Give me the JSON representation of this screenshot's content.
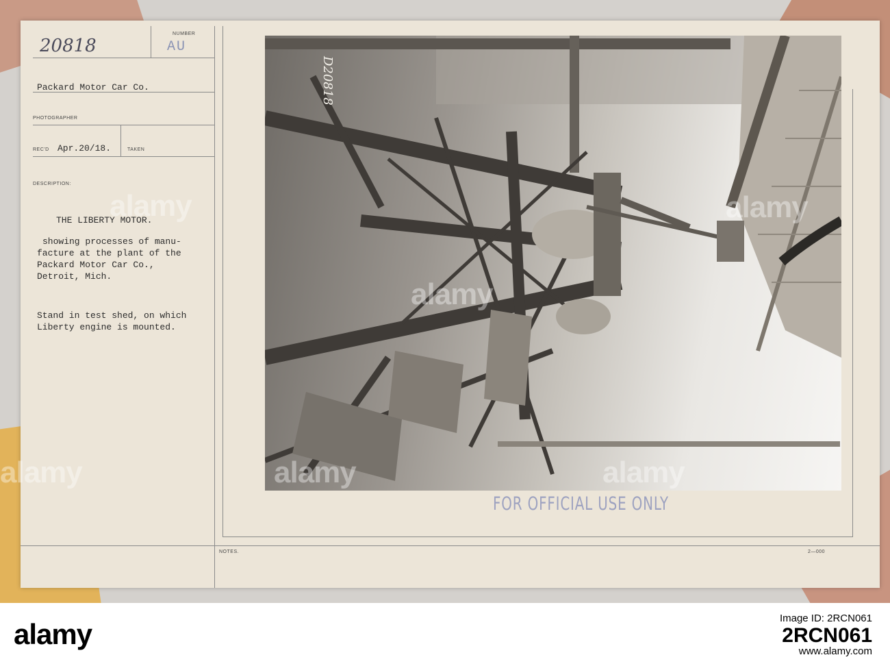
{
  "card": {
    "number_label": "NUMBER",
    "number_handwritten": "20818",
    "number_stamp": "AU",
    "source_value": "Packard Motor Car Co.",
    "photographer_label": "PHOTOGRAPHER",
    "recd_label": "REC'D",
    "recd_value": "Apr.20/18.",
    "taken_label": "TAKEN",
    "description_label": "DESCRIPTION:",
    "title": "THE LIBERTY MOTOR.",
    "desc_lines": [
      "showing processes of manu-",
      "facture at the plant of the",
      "Packard Motor Car Co.,",
      "Detroit, Mich."
    ],
    "caption_lines": [
      "Stand in test shed, on which",
      "Liberty engine is mounted."
    ],
    "notes_label": "NOTES.",
    "form_code": "2—000",
    "photo_number": "D20818",
    "official_stamp": "FOR OFFICIAL USE ONLY"
  },
  "watermarks": [
    "alamy",
    "alamy",
    "alamy",
    "alamy",
    "alamy",
    "alamy"
  ],
  "footer": {
    "logo": "alamy",
    "image_id_label": "Image ID: 2RCN061",
    "image_id": "2RCN061",
    "url": "www.alamy.com"
  }
}
